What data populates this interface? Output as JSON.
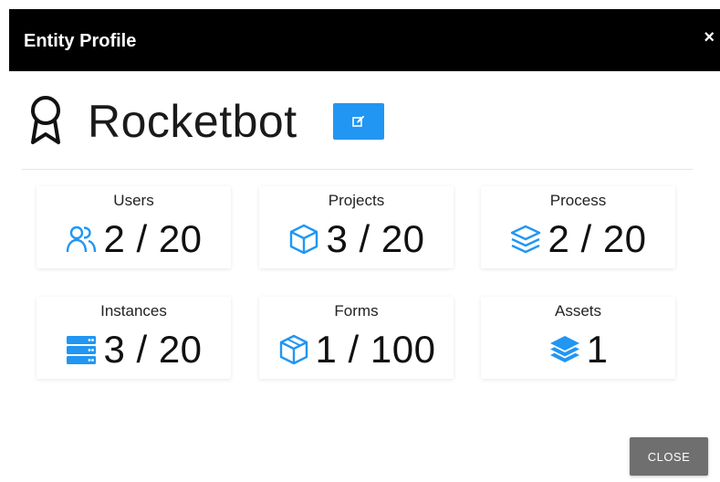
{
  "dialog": {
    "title": "Entity Profile",
    "close_glyph": "×"
  },
  "entity": {
    "name": "Rocketbot",
    "icon": "award-ribbon-icon",
    "edit_icon": "edit-icon"
  },
  "stats": [
    {
      "label": "Users",
      "value": "2 / 20",
      "icon": "users-icon"
    },
    {
      "label": "Projects",
      "value": "3 / 20",
      "icon": "box-icon"
    },
    {
      "label": "Process",
      "value": "2 / 20",
      "icon": "layers-icon"
    },
    {
      "label": "Instances",
      "value": "3 / 20",
      "icon": "server-icon"
    },
    {
      "label": "Forms",
      "value": "1 / 100",
      "icon": "cube-icon"
    },
    {
      "label": "Assets",
      "value": "1",
      "icon": "layers-solid-icon"
    }
  ],
  "footer": {
    "close_label": "CLOSE"
  },
  "colors": {
    "accent": "#2196f3",
    "titlebar": "#000000",
    "close_button": "#6f6f6f"
  }
}
